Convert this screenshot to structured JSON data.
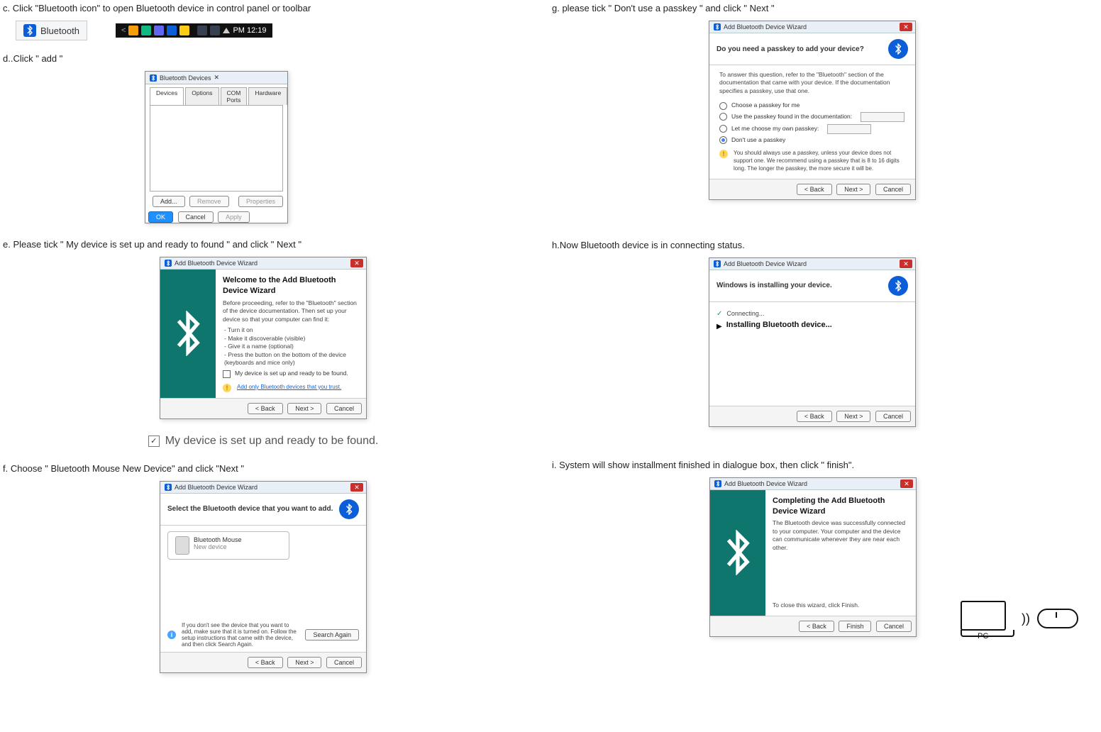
{
  "left": {
    "step_c": "c. Click \"Bluetooth icon\" to open Bluetooth device in control panel or toolbar",
    "bt_label": "Bluetooth",
    "tray_time": "PM 12:19",
    "step_d": "d..Click \" add \"",
    "btdev": {
      "title": "Bluetooth Devices",
      "tabs": [
        "Devices",
        "Options",
        "COM Ports",
        "Hardware"
      ],
      "btn_add": "Add...",
      "btn_remove": "Remove",
      "btn_props": "Properties",
      "btn_ok": "OK",
      "btn_cancel": "Cancel",
      "btn_apply": "Apply"
    },
    "step_e": "e. Please tick \" My device is set up and ready to found \" and click  \" Next \"",
    "wiz_e": {
      "title": "Add Bluetooth Device Wizard",
      "heading": "Welcome to the Add Bluetooth Device Wizard",
      "text1": "Before proceeding, refer to the \"Bluetooth\" section of the device documentation. Then set up your device so that your computer can find it:",
      "bullets": [
        "- Turn it on",
        "- Make it discoverable (visible)",
        "- Give it a name (optional)",
        "- Press the button on the bottom of the device (keyboards and mice only)"
      ],
      "check_label": "My device is set up and ready to be found.",
      "warn_link": "Add only Bluetooth devices that you trust.",
      "btn_back": "< Back",
      "btn_next": "Next >",
      "btn_cancel": "Cancel"
    },
    "checkline_text": "My device is set up and ready to be found.",
    "step_f": "f. Choose \" Bluetooth Mouse New Device\" and click \"Next \"",
    "wiz_f": {
      "title": "Add Bluetooth Device Wizard",
      "heading": "Select the Bluetooth device that you want to add.",
      "dev_name": "Bluetooth Mouse",
      "dev_sub": "New device",
      "info": "If you don't see the device that you want to add, make sure that it is turned on. Follow the setup instructions that came with the device, and then click Search Again.",
      "btn_search": "Search Again",
      "btn_back": "< Back",
      "btn_next": "Next >",
      "btn_cancel": "Cancel"
    }
  },
  "right": {
    "step_g": "g. please tick \" Don't use a passkey \" and click \" Next \"",
    "wiz_g": {
      "title": "Add Bluetooth Device Wizard",
      "heading": "Do you need a passkey to add your device?",
      "text": "To answer this question, refer to the \"Bluetooth\" section of the documentation that came with your device. If the documentation specifies a passkey, use that one.",
      "opt1": "Choose a passkey for me",
      "opt2": "Use the passkey found in the documentation:",
      "opt3": "Let me choose my own passkey:",
      "opt4": "Don't use a passkey",
      "warn": "You should always use a passkey, unless your device does not support one. We recommend using a passkey that is 8 to 16 digits long. The longer the passkey, the more secure it will be.",
      "btn_back": "< Back",
      "btn_next": "Next >",
      "btn_cancel": "Cancel"
    },
    "step_h": "h.Now Bluetooth device is in connecting status.",
    "wiz_h": {
      "title": "Add Bluetooth Device Wizard",
      "heading": "Windows is installing your device.",
      "s1": "Connecting...",
      "s2": "Installing Bluetooth device...",
      "btn_back": "< Back",
      "btn_next": "Next >",
      "btn_cancel": "Cancel"
    },
    "step_i": "i. System will show installment finished in dialogue box, then click \" finish\".",
    "wiz_i": {
      "title": "Add Bluetooth Device Wizard",
      "heading": "Completing the Add Bluetooth Device Wizard",
      "text1": "The Bluetooth device was successfully connected to your computer. Your computer and the device can communicate whenever they are near each other.",
      "text2": "To close this wizard, click Finish.",
      "btn_back": "< Back",
      "btn_finish": "Finish",
      "btn_cancel": "Cancel"
    }
  }
}
